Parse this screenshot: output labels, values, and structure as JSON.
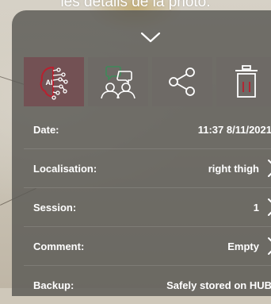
{
  "caption": "les détails de la photo.",
  "actions": {
    "ai_label": "AI"
  },
  "details": [
    {
      "label": "Date:",
      "value": "11:37 8/11/2021",
      "arrow": false
    },
    {
      "label": "Localisation:",
      "value": "right thigh",
      "arrow": true
    },
    {
      "label": "Session:",
      "value": "1",
      "arrow": true
    },
    {
      "label": "Comment:",
      "value": "Empty",
      "arrow": true
    },
    {
      "label": "Backup:",
      "value": "Safely stored on HUB",
      "arrow": false
    }
  ],
  "colors": {
    "panel": "#5c5b56",
    "accent_red": "#8a1e2c",
    "tile_red": "#735154",
    "chat_green": "#3f8a5a"
  }
}
